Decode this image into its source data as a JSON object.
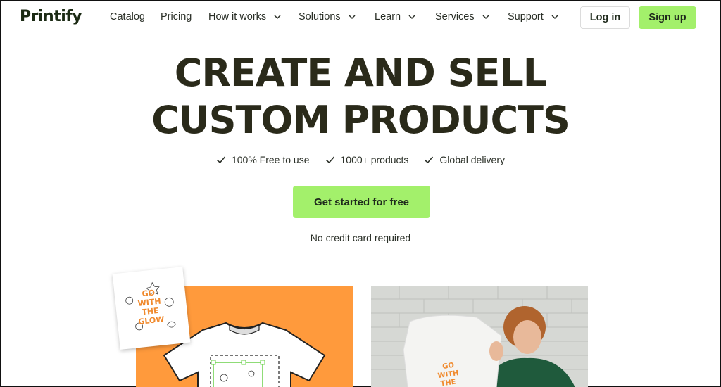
{
  "brand": {
    "logo_text": "Printify"
  },
  "nav": {
    "items": [
      {
        "label": "Catalog",
        "dropdown": false
      },
      {
        "label": "Pricing",
        "dropdown": false
      },
      {
        "label": "How it works",
        "dropdown": true
      },
      {
        "label": "Solutions",
        "dropdown": true
      },
      {
        "label": "Learn",
        "dropdown": true
      },
      {
        "label": "Services",
        "dropdown": true
      },
      {
        "label": "Support",
        "dropdown": true
      }
    ],
    "login_label": "Log in",
    "signup_label": "Sign up"
  },
  "hero": {
    "title_line1": "CREATE AND SELL",
    "title_line2": "CUSTOM PRODUCTS",
    "features": [
      "100% Free to use",
      "1000+ products",
      "Global delivery"
    ],
    "cta_label": "Get started for free",
    "note": "No credit card required"
  },
  "design_text": "GO WITH THE GLOW",
  "colors": {
    "accent_green": "#a3f06b",
    "dark_text": "#2a2a1a",
    "orange": "#ff9a3c"
  }
}
